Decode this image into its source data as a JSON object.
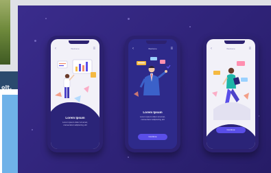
{
  "background": {
    "left_window": {
      "title_text": "olt."
    },
    "showcase_color": "#3a2c8c"
  },
  "phones": [
    {
      "id": "phone-1",
      "header_title": "Welcome",
      "screen_theme": "light",
      "card_title": "Lorem Ipsum",
      "card_text": "Lorem ipsum dolor sit amet, consectetur adipiscing elit",
      "button_label": "",
      "accent": "#4d43c9"
    },
    {
      "id": "phone-2",
      "header_title": "Welcome",
      "screen_theme": "dark",
      "card_title": "Lorem Ipsum",
      "card_text": "Lorem ipsum dolor sit amet, consectetur adipiscing elit",
      "button_label": "Continue",
      "accent": "#5a4ee8"
    },
    {
      "id": "phone-3",
      "header_title": "Welcome",
      "screen_theme": "light",
      "card_title": "",
      "card_text": "",
      "button_label": "Continue",
      "accent": "#5a4ee8"
    }
  ]
}
